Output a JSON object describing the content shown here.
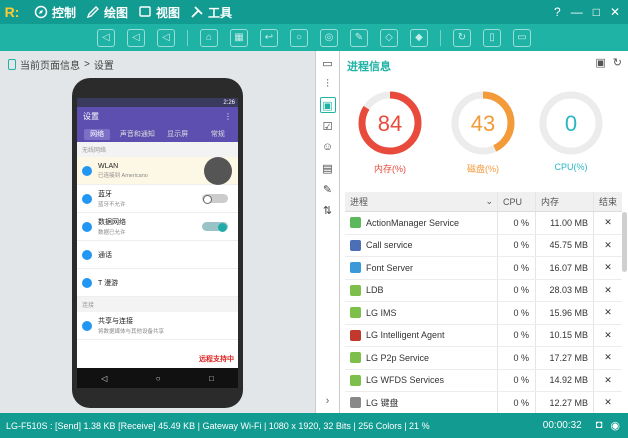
{
  "app": {
    "logo": "R:",
    "menus": [
      "控制",
      "绘图",
      "视图",
      "工具"
    ],
    "window_controls": [
      "?",
      "—",
      "□",
      "✕"
    ]
  },
  "colors": {
    "titlebar": "#129b91",
    "toolbar": "#1fb3a6",
    "memory": "#e84b3c",
    "disk": "#f39a3a",
    "cpu": "#2ab7c4"
  },
  "left": {
    "breadcrumb_root": "当前页面信息",
    "breadcrumb_sep": ">",
    "breadcrumb_current": "设置"
  },
  "phone": {
    "status_time": "2:26",
    "app_title": "设置",
    "tabs": [
      "网络",
      "声音和通知",
      "显示屏",
      "常规"
    ],
    "section_wireless": "无线网络",
    "rows": [
      {
        "title": "WLAN",
        "sub": "已连接到 Americano"
      },
      {
        "title": "蓝牙",
        "sub": "蓝牙不允许"
      },
      {
        "title": "数据网络",
        "sub": "数据已允许"
      },
      {
        "title": "通话",
        "sub": ""
      },
      {
        "title": "T 漫游",
        "sub": ""
      }
    ],
    "section_connect": "连接",
    "connect_row": {
      "title": "共享与连接",
      "sub": "将数据媒体与其他设备共享"
    },
    "remote_badge": "远程支持中",
    "nav": [
      "◁",
      "○",
      "□"
    ]
  },
  "panel": {
    "title": "进程信息",
    "gauges": [
      {
        "label": "内存(%)",
        "value": "84",
        "percent": 84,
        "color": "#e84b3c"
      },
      {
        "label": "磁盘(%)",
        "value": "43",
        "percent": 43,
        "color": "#f39a3a"
      },
      {
        "label": "CPU(%)",
        "value": "0",
        "percent": 0,
        "color": "#2ab7c4"
      }
    ],
    "columns": [
      "进程",
      "CPU",
      "内存",
      "结束"
    ],
    "processes": [
      {
        "name": "ActionManager Service",
        "cpu": "0 %",
        "mem": "11.00 MB",
        "end": "✕",
        "icon": "#5cb85c"
      },
      {
        "name": "Call service",
        "cpu": "0 %",
        "mem": "45.75 MB",
        "end": "✕",
        "icon": "#4a6fb5"
      },
      {
        "name": "Font Server",
        "cpu": "0 %",
        "mem": "16.07 MB",
        "end": "✕",
        "icon": "#3a9ad9"
      },
      {
        "name": "LDB",
        "cpu": "0 %",
        "mem": "28.03 MB",
        "end": "✕",
        "icon": "#7cc04b"
      },
      {
        "name": "LG IMS",
        "cpu": "0 %",
        "mem": "15.96 MB",
        "end": "✕",
        "icon": "#7cc04b"
      },
      {
        "name": "LG Intelligent Agent",
        "cpu": "0 %",
        "mem": "10.15 MB",
        "end": "✕",
        "icon": "#c0392b"
      },
      {
        "name": "LG P2p Service",
        "cpu": "0 %",
        "mem": "17.27 MB",
        "end": "✕",
        "icon": "#7cc04b"
      },
      {
        "name": "LG WFDS Services",
        "cpu": "0 %",
        "mem": "14.92 MB",
        "end": "✕",
        "icon": "#7cc04b"
      },
      {
        "name": "LG 键盘",
        "cpu": "0 %",
        "mem": "12.27 MB",
        "end": "✕",
        "icon": "#888888"
      }
    ]
  },
  "statusbar": {
    "info": "LG-F510S : [Send] 1.38 KB  [Receive] 45.49 KB | Gateway Wi-Fi | 1080 x 1920, 32 Bits | 256 Colors | 21 %",
    "timer": "00:00:32"
  }
}
